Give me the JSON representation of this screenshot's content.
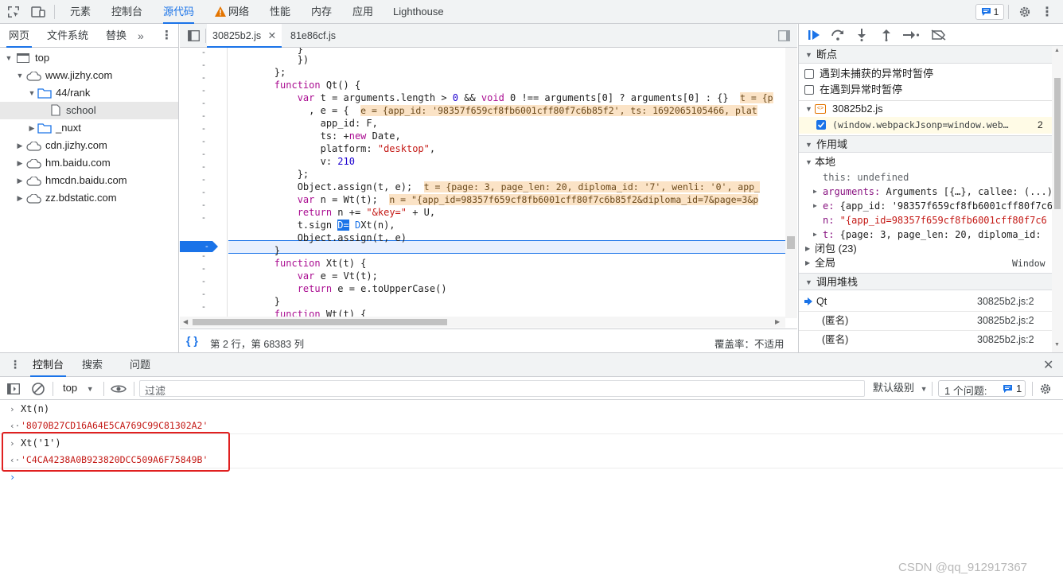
{
  "topbar": {
    "tabs": [
      "元素",
      "控制台",
      "源代码",
      "网络",
      "性能",
      "内存",
      "应用",
      "Lighthouse"
    ],
    "issues_badge": "1"
  },
  "navigator": {
    "tabs": [
      "网页",
      "文件系统",
      "替换"
    ],
    "tree": [
      "top",
      "www.jizhy.com",
      "44/rank",
      "school",
      "_nuxt",
      "cdn.jizhy.com",
      "hm.baidu.com",
      "hmcdn.baidu.com",
      "zz.bdstatic.com"
    ]
  },
  "editor": {
    "tabs": [
      "30825b2.js",
      "81e86cf.js"
    ],
    "gutter_mark": "-",
    "code": {
      "l0": "            }",
      "l1": "            })",
      "l2": "        };",
      "l3_kw": "function",
      "l3_rest": " Qt() {",
      "l4_kw": "var",
      "l4_rest": " t = arguments.length > ",
      "l4_num": "0",
      "l4_rest2": " && ",
      "l4_kw2": "void",
      "l4_rest3": " 0 !== arguments[0] ? arguments[0] : {}",
      "l4_inl": "t = {p",
      "l5": "              , e = {  ",
      "l5_inl": "e = {app_id: '98357f659cf8fb6001cff80f7c6b85f2', ts: 1692065105466, plat",
      "l6": "                app_id: F,",
      "l7": "                ts: +",
      "l7_kw": "new",
      "l7_rest": " Date,",
      "l8": "                platform: ",
      "l8_str": "\"desktop\"",
      "l8_rest": ",",
      "l9": "                v: ",
      "l9_num": "210",
      "l10": "            };",
      "l11": "            Object.assign(t, e);  ",
      "l11_inl": "t = {page: 3, page_len: 20, diploma_id: '7', wenli: '0', app_",
      "l12_kw": "var",
      "l12_rest": " n = Wt(t);  ",
      "l12_inl": "n = \"{app_id=98357f659cf8fb6001cff80f7c6b85f2&diploma_id=7&page=3&p",
      "l13_kw": "return",
      "l13_rest": " n += ",
      "l13_str": "\"&key=\"",
      "l13_rest2": " + U,",
      "l14": "            t.sign ",
      "l14_b": "D=",
      "l14_c": " D",
      "l14_rest": "Xt(n),",
      "l15": "            Object.assign(t, e)",
      "l16": "        }",
      "l17_kw": "function",
      "l17_rest": " Xt(t) {",
      "l18_kw": "var",
      "l18_rest": " e = Vt(t);",
      "l19_kw": "return",
      "l19_rest": " e = e.toUpperCase()",
      "l20": "        }",
      "l21_kw": "function",
      "l21_rest": " Wt(t) {"
    },
    "status_left": "第 2 行，第 68383 列",
    "status_right": "覆盖率：不适用"
  },
  "debugger": {
    "breakpoints_title": "断点",
    "pause_uncaught": "遇到未捕获的异常时暂停",
    "pause_caught": "在遇到异常时暂停",
    "file": "30825b2.js",
    "bp_text": "(window.webpackJsonp=window.web…",
    "bp_line": "2",
    "scope_title": "作用域",
    "local": "本地",
    "this_key": "this:",
    "this_val": " undefined",
    "arguments_key": "arguments:",
    "arguments_val": " Arguments [{…}, callee: (...)",
    "e_key": "e:",
    "e_val": " {app_id: '98357f659cf8fb6001cff80f7c6",
    "n_key": "n:",
    "n_val": " \"{app_id=98357f659cf8fb6001cff80f7c6",
    "t_key": "t:",
    "t_val": " {page: 3, page_len: 20, diploma_id:",
    "closure": "闭包 (23)",
    "global": "全局",
    "global_val": "Window",
    "callstack_title": "调用堆栈",
    "frames": [
      {
        "name": "Qt",
        "loc": "30825b2.js:2"
      },
      {
        "name": "(匿名)",
        "loc": "30825b2.js:2"
      },
      {
        "name": "(匿名)",
        "loc": "30825b2.js:2"
      }
    ]
  },
  "drawer": {
    "tabs": [
      "控制台",
      "搜索",
      "问题"
    ],
    "context": "top",
    "filter_placeholder": "过滤",
    "levels": "默认级别",
    "issues_label": "1 个问题:",
    "issues_count": "1"
  },
  "console": {
    "in1": "Xt(n)",
    "out1": "'8070B27CD16A64E5CA769C99C81302A2'",
    "in2": "Xt('1')",
    "out2": "'C4CA4238A0B923820DCC509A6F75849B'"
  },
  "watermark": "CSDN @qq_912917367",
  "colors": {
    "accent": "#1a73e8",
    "highlight_box": "#e02020",
    "string": "#c41a16"
  }
}
